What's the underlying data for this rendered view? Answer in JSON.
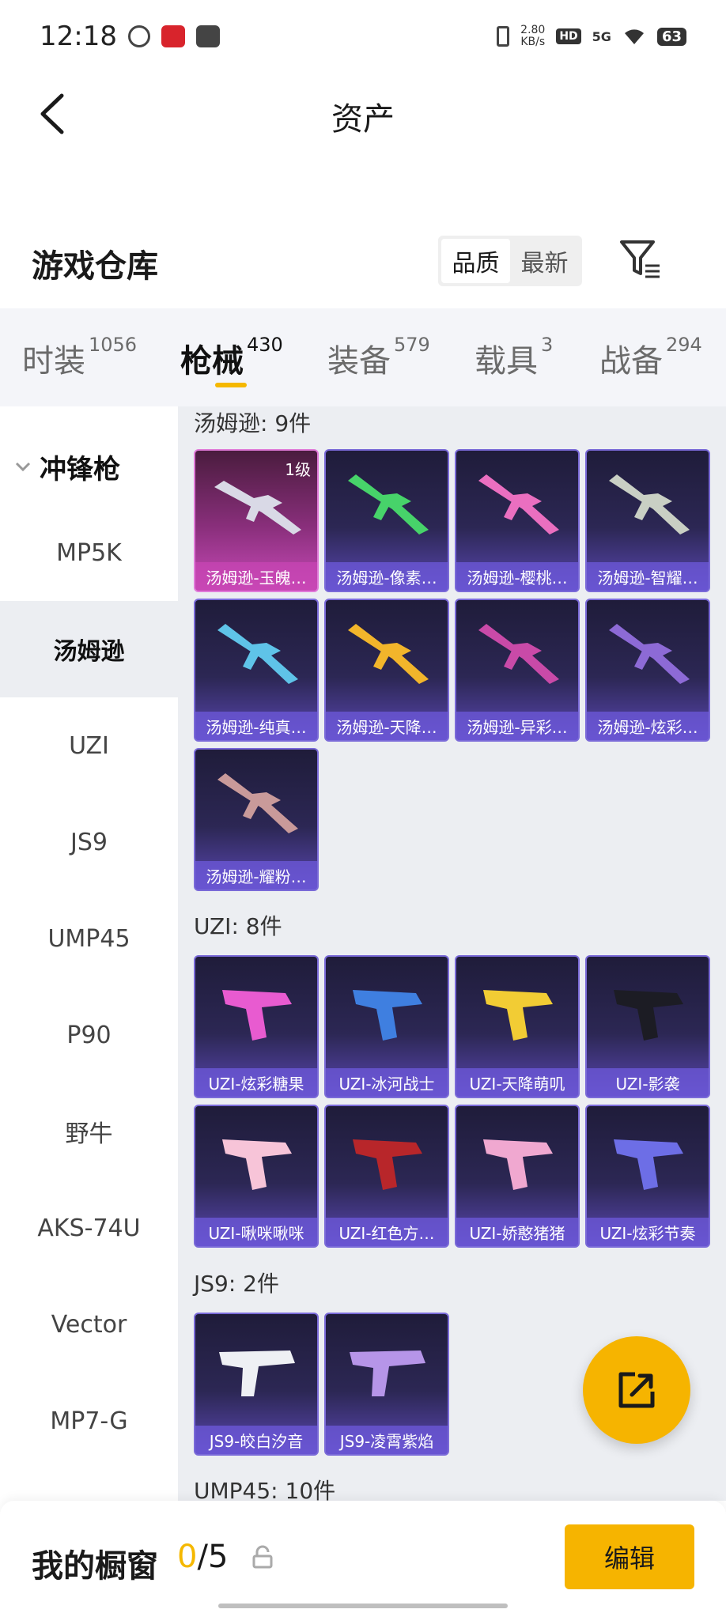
{
  "status_bar": {
    "time": "12:18",
    "speed_value": "2.80",
    "speed_unit": "KB/s",
    "hd": "HD",
    "network": "5G",
    "battery": "63"
  },
  "header": {
    "title": "资产"
  },
  "section": {
    "title": "游戏仓库",
    "sort_options": [
      "品质",
      "最新"
    ],
    "sort_active": "品质"
  },
  "tabs": [
    {
      "label": "时装",
      "count": "1056"
    },
    {
      "label": "枪械",
      "count": "430"
    },
    {
      "label": "装备",
      "count": "579"
    },
    {
      "label": "载具",
      "count": "3"
    },
    {
      "label": "战备",
      "count": "294"
    }
  ],
  "active_tab": "枪械",
  "sidebar": {
    "group": "冲锋枪",
    "items": [
      "MP5K",
      "汤姆逊",
      "UZI",
      "JS9",
      "UMP45",
      "P90",
      "野牛",
      "AKS-74U",
      "Vector",
      "MP7-G"
    ],
    "active": "汤姆逊"
  },
  "groups": [
    {
      "title": "汤姆逊: 9件",
      "items": [
        {
          "label": "汤姆逊-玉魄…",
          "level": "1级",
          "rarity": "pink"
        },
        {
          "label": "汤姆逊-像素…"
        },
        {
          "label": "汤姆逊-樱桃…"
        },
        {
          "label": "汤姆逊-智耀…"
        },
        {
          "label": "汤姆逊-纯真…"
        },
        {
          "label": "汤姆逊-天降…"
        },
        {
          "label": "汤姆逊-异彩…"
        },
        {
          "label": "汤姆逊-炫彩…"
        },
        {
          "label": "汤姆逊-耀粉…"
        }
      ]
    },
    {
      "title": "UZI: 8件",
      "items": [
        {
          "label": "UZI-炫彩糖果"
        },
        {
          "label": "UZI-冰河战士"
        },
        {
          "label": "UZI-天降萌叽"
        },
        {
          "label": "UZI-影袭"
        },
        {
          "label": "UZI-啾咪啾咪"
        },
        {
          "label": "UZI-红色方…"
        },
        {
          "label": "UZI-娇憨猪猪"
        },
        {
          "label": "UZI-炫彩节奏"
        }
      ]
    },
    {
      "title": "JS9: 2件",
      "items": [
        {
          "label": "JS9-皎白汐音"
        },
        {
          "label": "JS9-凌霄紫焰"
        }
      ]
    },
    {
      "title": "UMP45: 10件",
      "items": []
    }
  ],
  "bottom_bar": {
    "title": "我的橱窗",
    "current": "0",
    "separator": "/",
    "total": "5",
    "edit_label": "编辑"
  },
  "colors": {
    "accent": "#f6b400",
    "card_purple": "#5a47b2",
    "card_pink": "#c84ab8"
  },
  "icons": [
    "back-arrow-icon",
    "filter-icon",
    "chevron-down-icon",
    "share-icon",
    "lock-icon"
  ]
}
